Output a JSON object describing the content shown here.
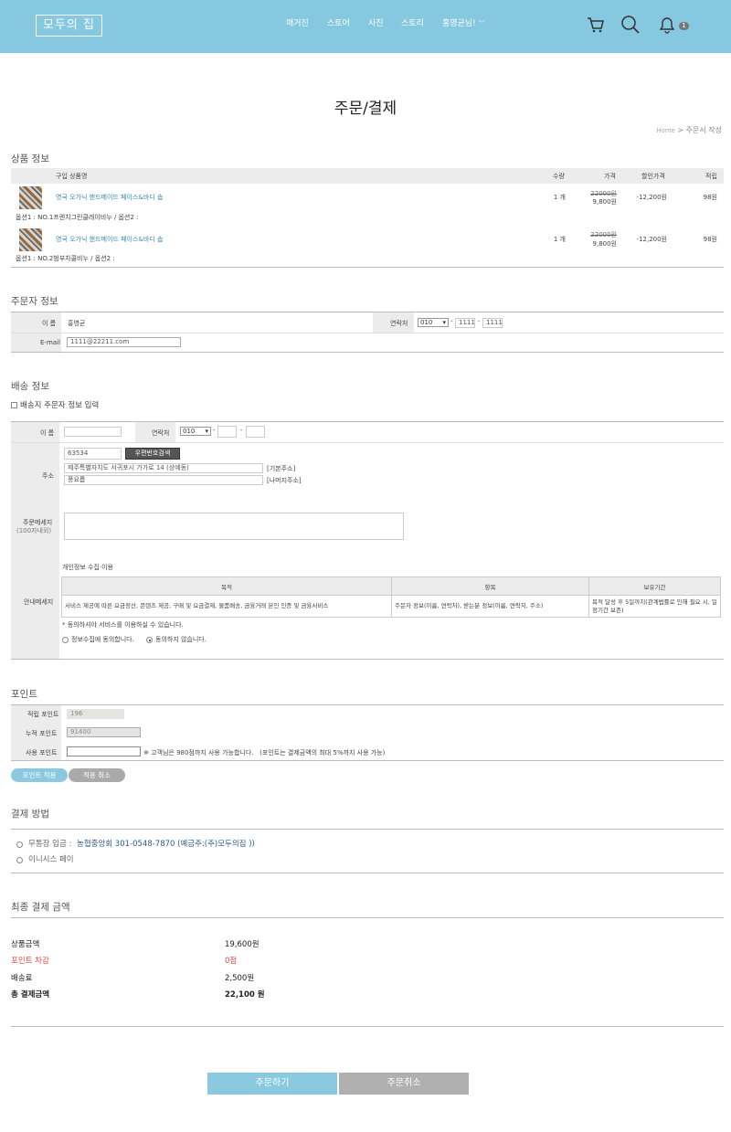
{
  "header": {
    "logo": "모두의 집",
    "nav": [
      "매거진",
      "스토어",
      "사진",
      "스토리"
    ],
    "user": "홍영균님!",
    "notification_count": "1"
  },
  "page": {
    "title": "주문/결제",
    "breadcrumb_home": "Home",
    "breadcrumb_current": "> 주문서 작성"
  },
  "products": {
    "section_title": "상품 정보",
    "columns": [
      "구입 상품명",
      "수량",
      "가격",
      "할인가격",
      "적립"
    ],
    "rows": [
      {
        "name": "영국 오가닉 핸드메이드 페이스&바디 솝",
        "qty": "1 개",
        "price_original": "22000원",
        "price": "9,800원",
        "discount": "-12,200원",
        "points": "98원",
        "option": "옵션1 : NO.1프렌치그린클레이비누 / 옵션2 :"
      },
      {
        "name": "영국 오가닉 핸드메이드 페이스&바디 솝",
        "qty": "1 개",
        "price_original": "22000원",
        "price": "9,800원",
        "discount": "-12,200원",
        "points": "98원",
        "option": "옵션1 : NO.2범부차콜비누 / 옵션2 :"
      }
    ]
  },
  "orderer": {
    "section_title": "주문자 정보",
    "name_label": "이 름",
    "name_value": "홍영균",
    "phone_label": "연락처",
    "phone_prefix": "010",
    "phone_mid": "1111",
    "phone_last": "1111",
    "email_label": "E-mail",
    "email_value": "1111@22211.com"
  },
  "shipping": {
    "section_title": "배송 정보",
    "same_as_orderer": "배송지 주문자 정보 입력",
    "name_label": "이 름",
    "phone_label": "연락처",
    "phone_prefix": "010",
    "address_label": "주소",
    "zipcode": "63534",
    "zip_button": "우편번호검색",
    "address1": "제주특별자치도 서귀포시 가가로 14 (상예동)",
    "address1_tag": "[기본주소]",
    "address2": "풍요롭",
    "address2_tag": "[나머지주소]",
    "message_label": "주문메세지",
    "message_sub": "(100자내외)",
    "notice_label": "안내메세지",
    "privacy_title": "개인정보 수집·이용",
    "privacy_headers": [
      "목적",
      "항목",
      "보유기간"
    ],
    "privacy_row": [
      "서비스 제공에 따른 요금정산, 콘텐츠 제공, 구매 및 요금결제, 물품배송, 금융거래 본인 인증 및 금융서비스",
      "주문자 정보(이름, 연락처), 받는분 정보(이름, 연락처, 주소)",
      "목적 달성 후 5일까지(관계법률로 인해 필요 시, 일정기간 보존)"
    ],
    "privacy_note": "* 동의하셔야 서비스를 이용하실 수 있습니다.",
    "agree": "정보수집에 동의합니다.",
    "disagree": "동의하지 않습니다."
  },
  "points": {
    "section_title": "포인트",
    "earn_label": "적립 포인트",
    "earn_value": "196",
    "total_label": "누적 포인트",
    "total_value": "91400",
    "use_label": "사용 포인트",
    "use_note": "※ 고객님은 980점까지 사용 가능합니다.   (포인트는 결제금액의 최대 5%까지 사용 가능)",
    "apply_button": "포인트 적용",
    "cancel_button": "적용 취소"
  },
  "payment": {
    "section_title": "결제 방법",
    "bank_label": "무통장 입금 :",
    "bank_detail": "농협중앙회 301-0548-7870 (예금주:(주)모두의집 ))",
    "inicis": "이니시스 페이"
  },
  "summary": {
    "section_title": "최종 결제 금액",
    "items": [
      {
        "label": "상품금액",
        "value": "19,600원"
      },
      {
        "label": "포인트 차감",
        "value": "0점"
      },
      {
        "label": "배송료",
        "value": "2,500원"
      },
      {
        "label": "총 결제금액",
        "value": "22,100 원"
      }
    ]
  },
  "actions": {
    "order": "주문하기",
    "cancel": "주문취소"
  },
  "colors": {
    "header": "#85c8df",
    "accent_button": "#8ac9e0",
    "gray_button": "#b0b0b0",
    "point_deduct": "#d9473f"
  }
}
